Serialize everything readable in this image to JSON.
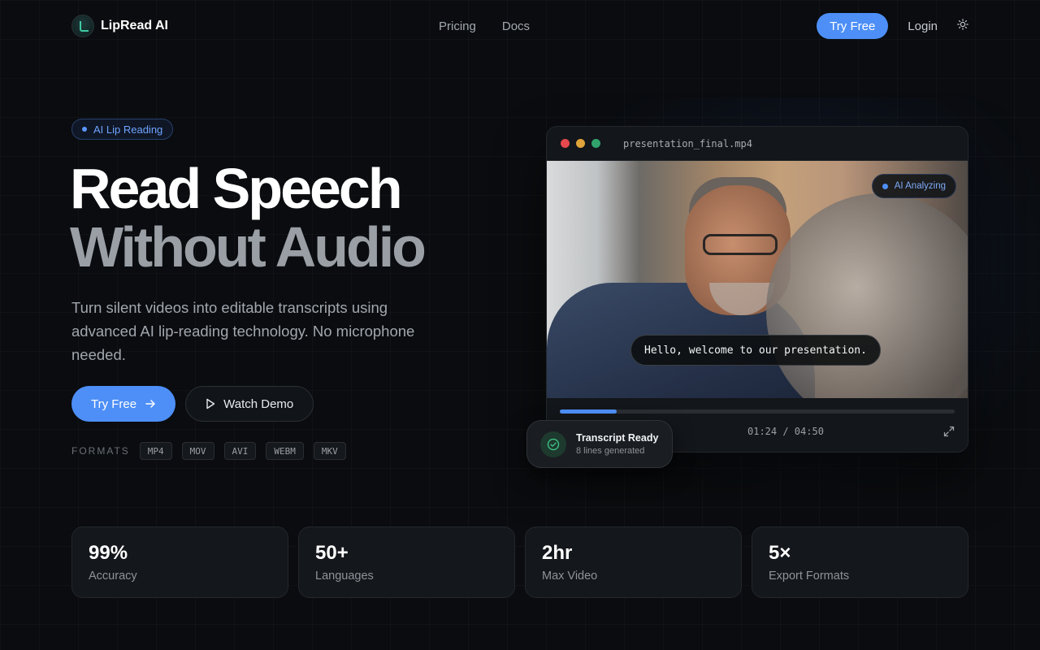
{
  "nav": {
    "brand": "LipRead AI",
    "links": [
      "Pricing",
      "Docs"
    ],
    "try_free": "Try Free",
    "login": "Login"
  },
  "hero": {
    "badge": "AI Lip Reading",
    "title_line1": "Read Speech",
    "title_line2": "Without Audio",
    "subtitle": "Turn silent videos into editable transcripts using advanced AI lip-reading technology. No microphone needed.",
    "primary_cta": "Try Free",
    "secondary_cta": "Watch Demo",
    "formats_label": "FORMATS",
    "formats": [
      "MP4",
      "MOV",
      "AVI",
      "WEBM",
      "MKV"
    ]
  },
  "player": {
    "filename": "presentation_final.mp4",
    "status_badge": "AI Analyzing",
    "caption": "Hello, welcome to our presentation.",
    "time": "01:24 / 04:50",
    "progress": 0.145,
    "window_dots": [
      "#e5484d",
      "#e0a43a",
      "#30a46c"
    ]
  },
  "toast": {
    "title": "Transcript Ready",
    "subtitle": "8 lines generated"
  },
  "stats": [
    {
      "value": "99%",
      "label": "Accuracy"
    },
    {
      "value": "50+",
      "label": "Languages"
    },
    {
      "value": "2hr",
      "label": "Max Video"
    },
    {
      "value": "5×",
      "label": "Export Formats"
    }
  ],
  "colors": {
    "accent": "#4d8ff7",
    "success": "#3fc98a"
  }
}
